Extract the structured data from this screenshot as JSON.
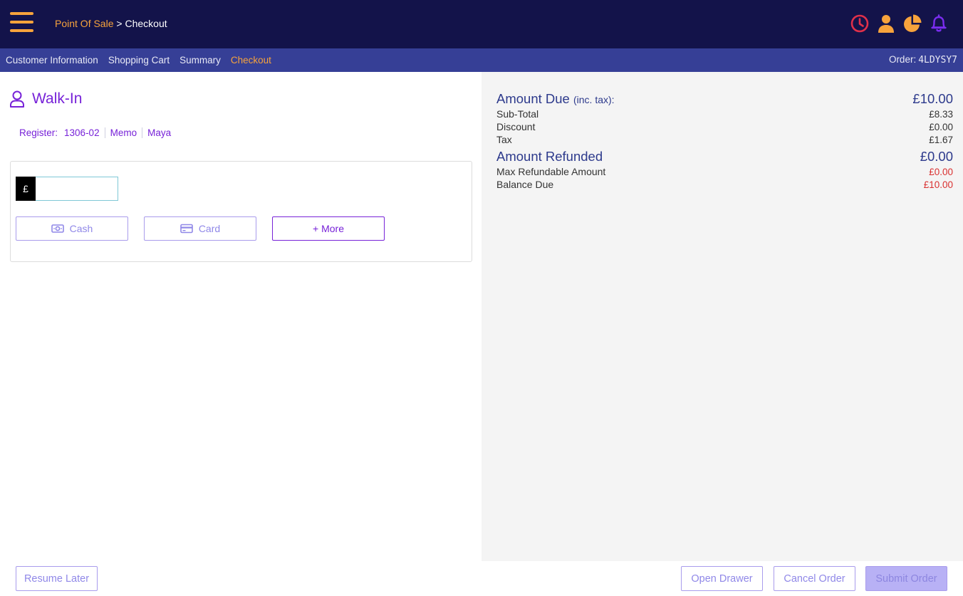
{
  "header": {
    "breadcrumb_root": "Point Of Sale",
    "breadcrumb_separator": " > ",
    "breadcrumb_current": "Checkout",
    "icons": [
      "clock-icon",
      "user-icon",
      "pie-chart-icon",
      "bell-icon"
    ],
    "colors": {
      "background": "#13134a",
      "accent": "#f7a33c",
      "clock": "#e0304a",
      "bell": "#7a2df0"
    }
  },
  "nav": {
    "tabs": [
      {
        "label": "Customer Information",
        "active": false
      },
      {
        "label": "Shopping Cart",
        "active": false
      },
      {
        "label": "Summary",
        "active": false
      },
      {
        "label": "Checkout",
        "active": true
      }
    ],
    "order_label": "Order:",
    "order_id": "4LDYSY7",
    "colors": {
      "background": "#363f96"
    }
  },
  "customer": {
    "name": "Walk-In",
    "register_label": "Register:",
    "register_value": "1306-02",
    "memo_label": "Memo",
    "user": "Maya"
  },
  "payment": {
    "currency_symbol": "£",
    "amount_value": "",
    "cash_label": "Cash",
    "card_label": "Card",
    "more_label": "+ More"
  },
  "summary": {
    "amount_due_label": "Amount Due",
    "amount_due_suffix": "(inc. tax):",
    "amount_due": "£10.00",
    "subtotal_label": "Sub-Total",
    "subtotal": "£8.33",
    "discount_label": "Discount",
    "discount": "£0.00",
    "tax_label": "Tax",
    "tax": "£1.67",
    "refunded_label": "Amount Refunded",
    "refunded": "£0.00",
    "max_refundable_label": "Max Refundable Amount",
    "max_refundable": "£0.00",
    "balance_due_label": "Balance Due",
    "balance_due": "£10.00"
  },
  "footer": {
    "resume_label": "Resume Later",
    "open_drawer_label": "Open Drawer",
    "cancel_label": "Cancel Order",
    "submit_label": "Submit Order"
  }
}
